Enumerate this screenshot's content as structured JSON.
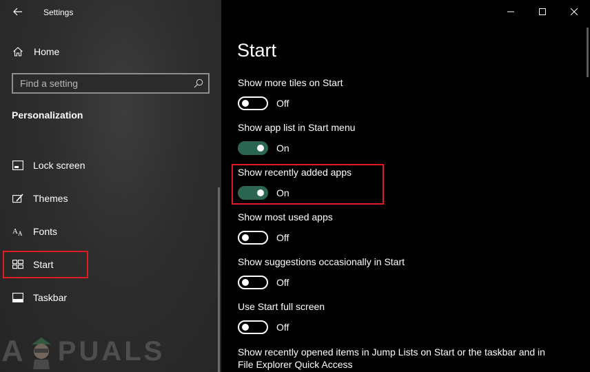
{
  "window": {
    "title": "Settings",
    "controls": {
      "minimize": "minimize-icon",
      "maximize": "maximize-icon",
      "close": "close-icon"
    }
  },
  "sidebar": {
    "home_label": "Home",
    "search_placeholder": "Find a setting",
    "section_title": "Personalization",
    "items": [
      {
        "label": "Lock screen",
        "icon": "lock-screen-icon"
      },
      {
        "label": "Themes",
        "icon": "themes-icon"
      },
      {
        "label": "Fonts",
        "icon": "fonts-icon"
      },
      {
        "label": "Start",
        "icon": "start-icon",
        "selected": true
      },
      {
        "label": "Taskbar",
        "icon": "taskbar-icon"
      }
    ]
  },
  "main": {
    "title": "Start",
    "settings": [
      {
        "label": "Show more tiles on Start",
        "state": "Off",
        "on": false
      },
      {
        "label": "Show app list in Start menu",
        "state": "On",
        "on": true
      },
      {
        "label": "Show recently added apps",
        "state": "On",
        "on": true
      },
      {
        "label": "Show most used apps",
        "state": "Off",
        "on": false
      },
      {
        "label": "Show suggestions occasionally in Start",
        "state": "Off",
        "on": false
      },
      {
        "label": "Use Start full screen",
        "state": "Off",
        "on": false
      },
      {
        "label": "Show recently opened items in Jump Lists on Start or the taskbar and in File Explorer Quick Access"
      }
    ]
  },
  "watermark": {
    "text_a": "A",
    "text_rest": "PUALS"
  },
  "colors": {
    "toggle_on": "#2c6653",
    "highlight": "#e01b24",
    "sidebar_bg": "#2d2d2d",
    "main_bg": "#000000"
  }
}
